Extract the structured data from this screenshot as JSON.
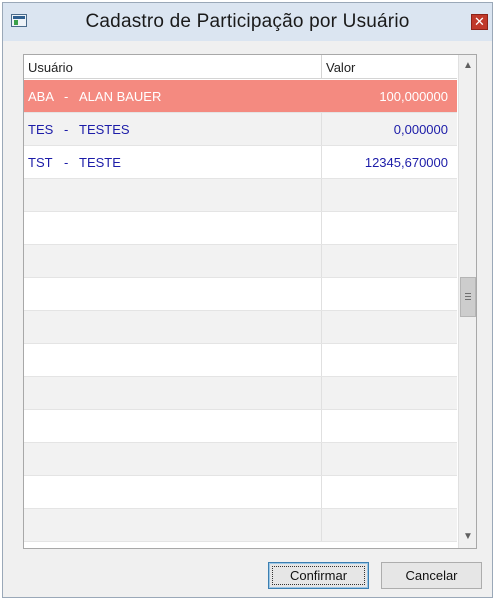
{
  "window": {
    "title": "Cadastro de Participação por Usuário",
    "icon": "window-app-icon",
    "close_label": "✕"
  },
  "grid": {
    "columns": [
      "Usuário",
      "Valor"
    ],
    "rows": [
      {
        "code": "ABA",
        "name": "ALAN BAUER",
        "value": "100,000000",
        "selected": true
      },
      {
        "code": "TES",
        "name": "TESTES",
        "value": "0,000000",
        "selected": false
      },
      {
        "code": "TST",
        "name": "TESTE",
        "value": "12345,670000",
        "selected": false
      }
    ],
    "separator": "-",
    "empty_rows": 11
  },
  "buttons": {
    "confirm": "Confirmar",
    "cancel": "Cancelar"
  },
  "colors": {
    "selected_row": "#f48a80",
    "row_text": "#1c1ca8"
  }
}
